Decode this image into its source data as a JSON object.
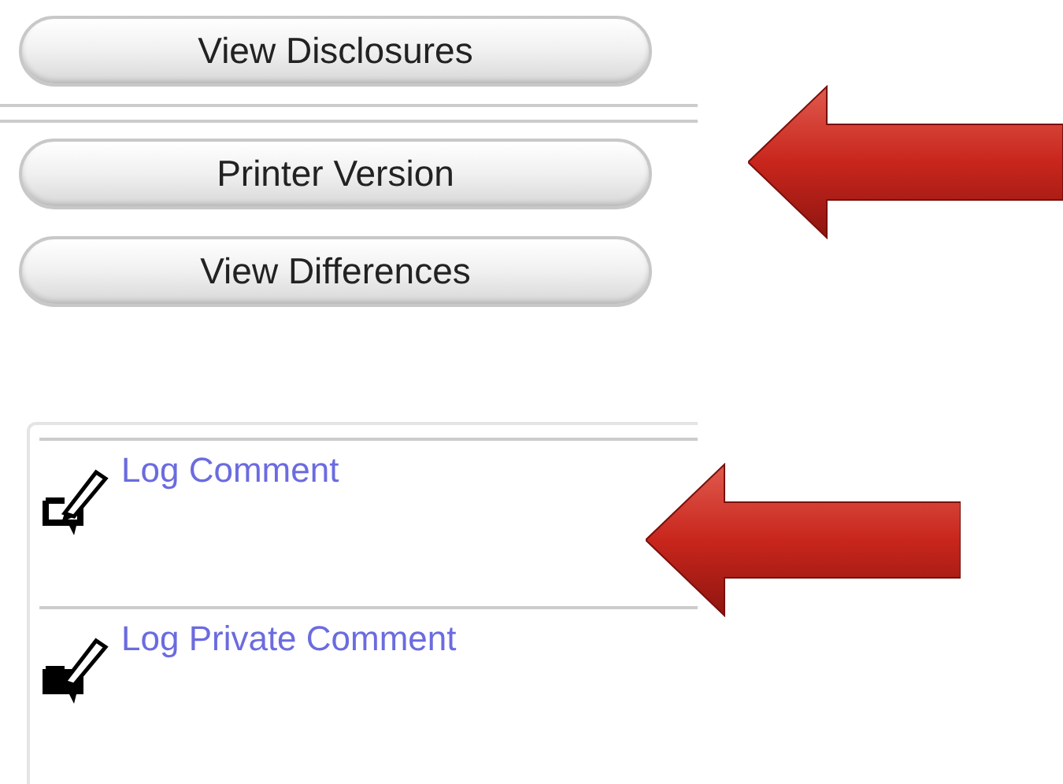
{
  "buttons": [
    "View Disclosures",
    "Printer Version",
    "View Differences"
  ],
  "comments": [
    {
      "label": "Log Comment",
      "kind": "outline"
    },
    {
      "label": "Log Private Comment",
      "kind": "filled"
    }
  ]
}
